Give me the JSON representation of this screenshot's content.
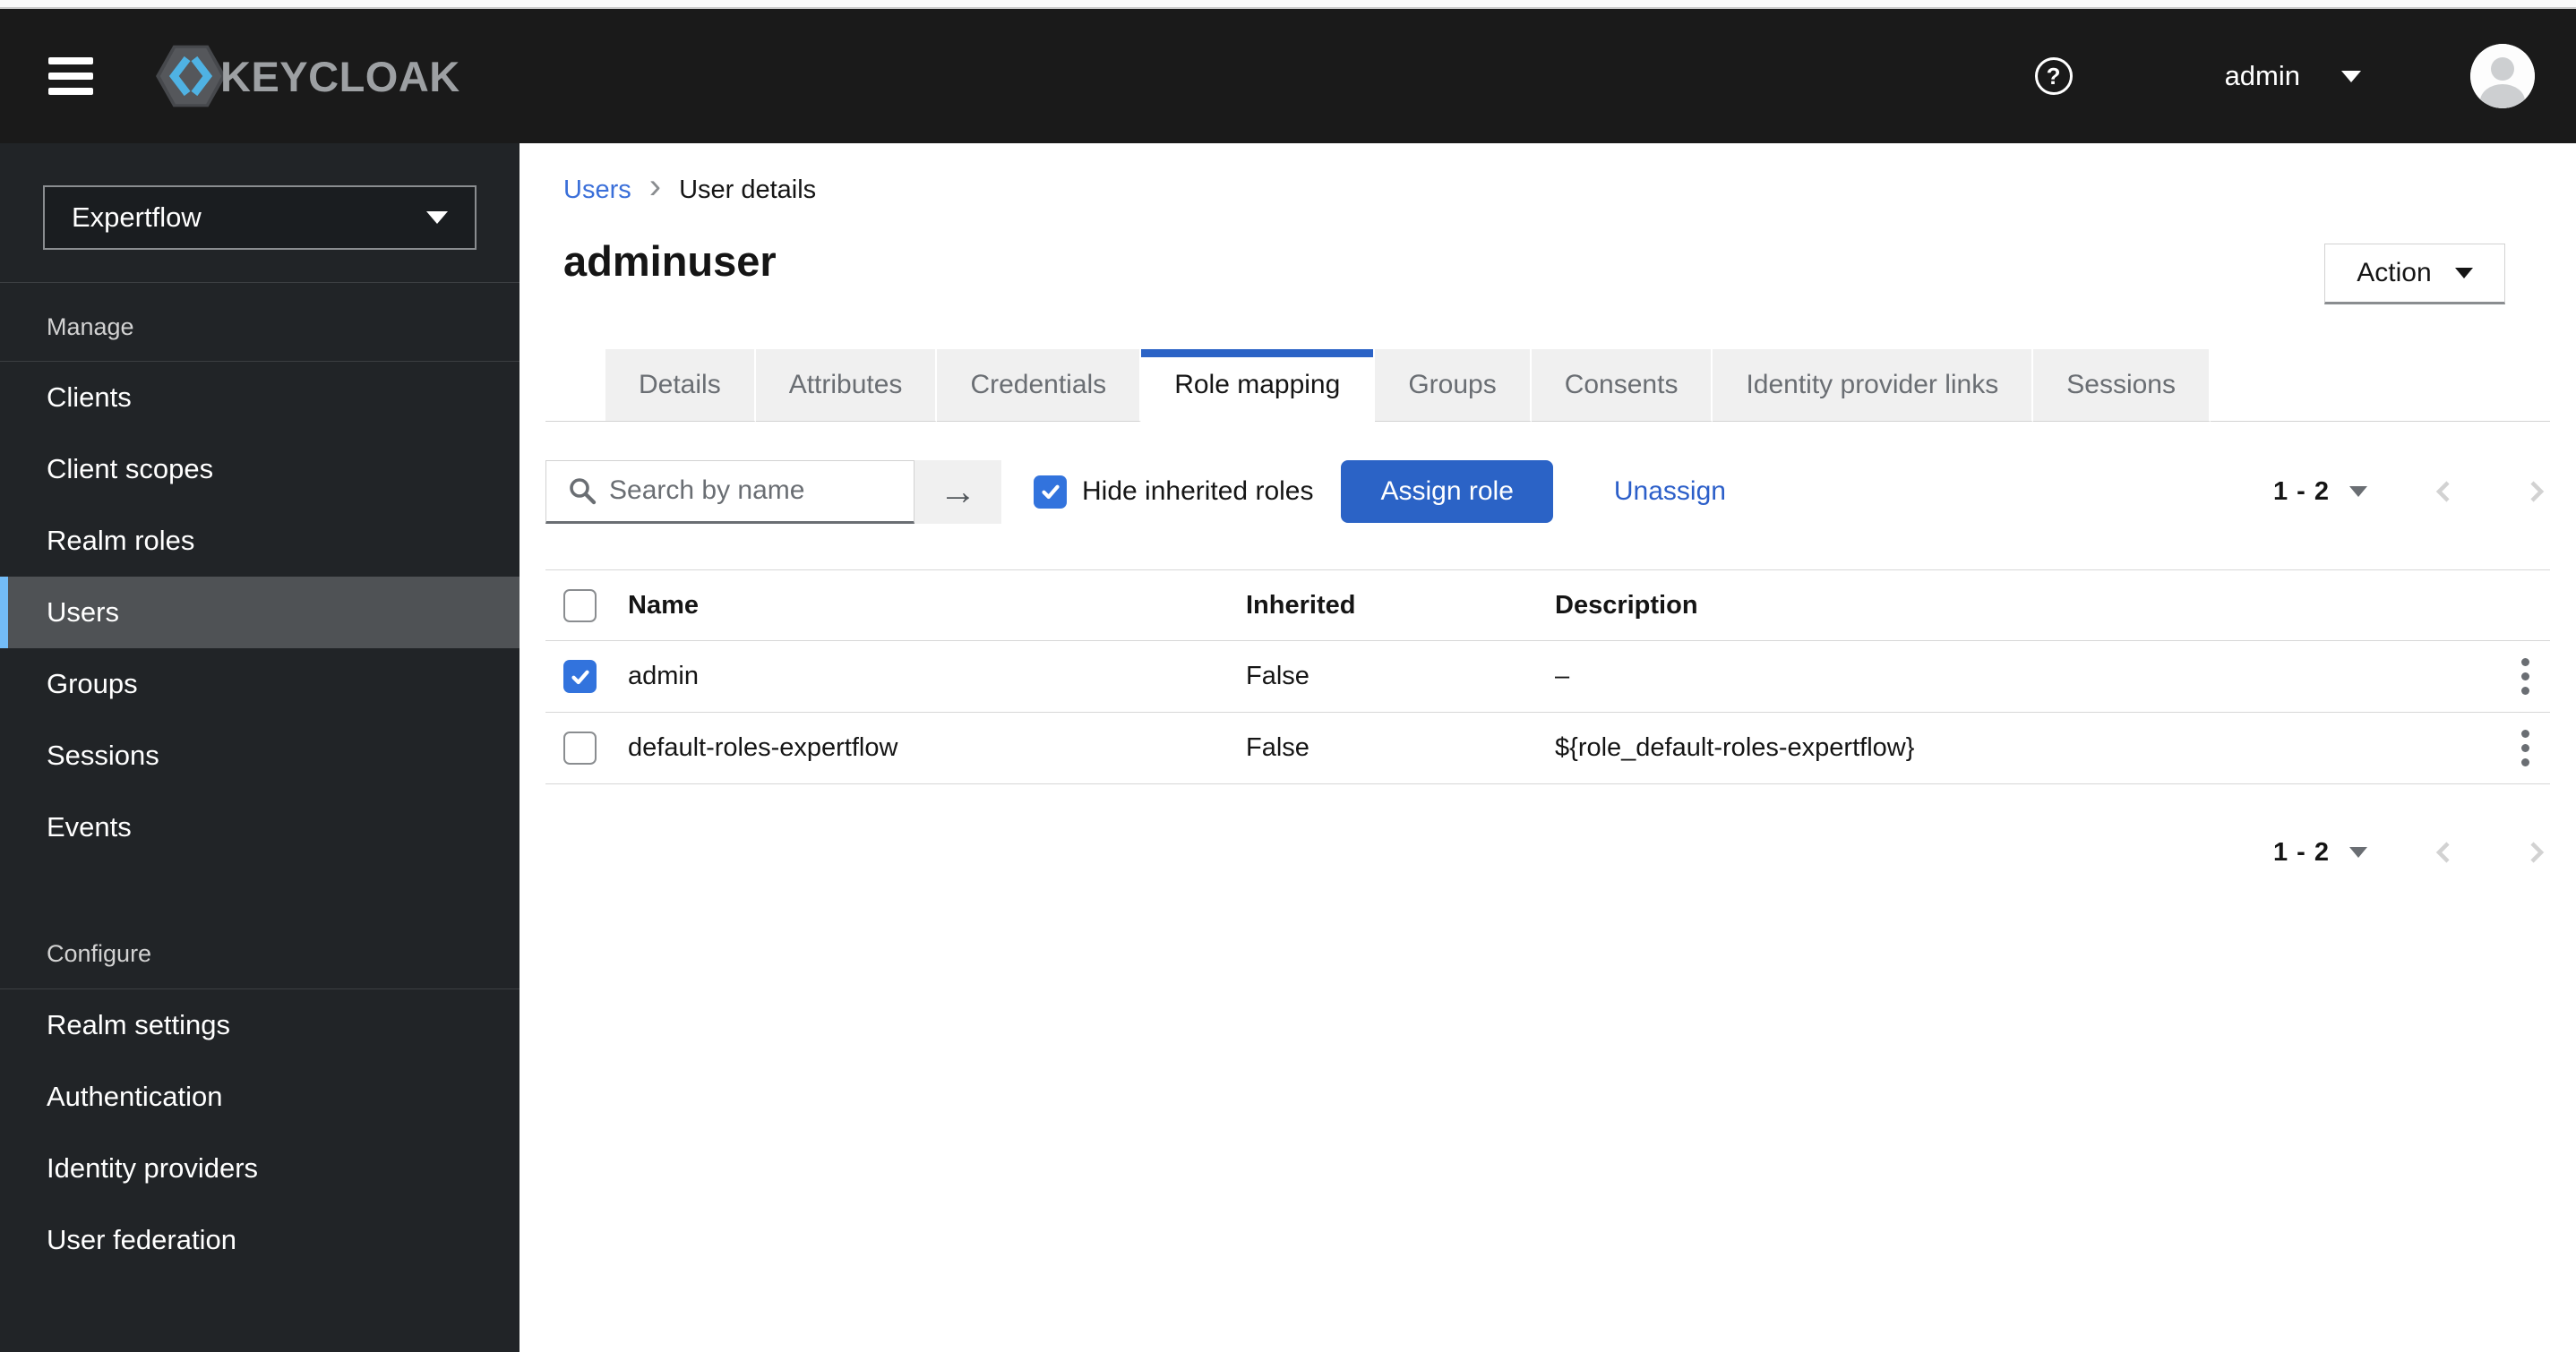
{
  "masthead": {
    "brand": "KEYCLOAK",
    "username": "admin",
    "help_glyph": "?"
  },
  "sidebar": {
    "realm_selector": {
      "value": "Expertflow"
    },
    "sections": [
      {
        "title": "Manage",
        "items": [
          {
            "label": "Clients",
            "selected": false
          },
          {
            "label": "Client scopes",
            "selected": false
          },
          {
            "label": "Realm roles",
            "selected": false
          },
          {
            "label": "Users",
            "selected": true
          },
          {
            "label": "Groups",
            "selected": false
          },
          {
            "label": "Sessions",
            "selected": false
          },
          {
            "label": "Events",
            "selected": false
          }
        ]
      },
      {
        "title": "Configure",
        "items": [
          {
            "label": "Realm settings",
            "selected": false
          },
          {
            "label": "Authentication",
            "selected": false
          },
          {
            "label": "Identity providers",
            "selected": false
          },
          {
            "label": "User federation",
            "selected": false
          }
        ]
      }
    ]
  },
  "breadcrumb": {
    "link": "Users",
    "current": "User details"
  },
  "page": {
    "title": "adminuser",
    "action_label": "Action"
  },
  "tabs": [
    {
      "label": "Details",
      "active": false
    },
    {
      "label": "Attributes",
      "active": false
    },
    {
      "label": "Credentials",
      "active": false
    },
    {
      "label": "Role mapping",
      "active": true
    },
    {
      "label": "Groups",
      "active": false
    },
    {
      "label": "Consents",
      "active": false
    },
    {
      "label": "Identity provider links",
      "active": false
    },
    {
      "label": "Sessions",
      "active": false
    }
  ],
  "toolbar": {
    "search_placeholder": "Search by name",
    "hide_inherited_label": "Hide inherited roles",
    "hide_inherited_checked": true,
    "assign_button": "Assign role",
    "unassign_link": "Unassign"
  },
  "pagination": {
    "range": "1 - 2"
  },
  "table": {
    "columns": [
      "Name",
      "Inherited",
      "Description"
    ],
    "rows": [
      {
        "checked": true,
        "name": "admin",
        "inherited": "False",
        "description": "–"
      },
      {
        "checked": false,
        "name": "default-roles-expertflow",
        "inherited": "False",
        "description": "${role_default-roles-expertflow}"
      }
    ]
  },
  "colors": {
    "masthead_bg": "#1a1a1a",
    "sidebar_bg": "#212427",
    "selected_nav_bg": "#4f5255",
    "nav_indicator_blue": "#73bcf7",
    "accent_blue": "#2b63c6",
    "checkbox_blue": "#3273dd",
    "link_blue": "#2c5fc9",
    "breadcrumb_link_blue": "#3a6fd9",
    "tab_inactive_bg": "#f0f0f0",
    "muted_text": "#6a6e73"
  }
}
